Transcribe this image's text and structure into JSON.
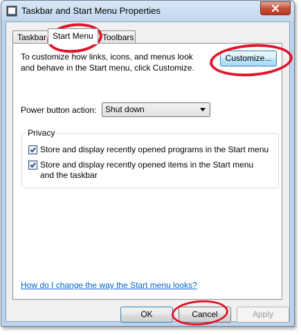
{
  "window": {
    "title": "Taskbar and Start Menu Properties"
  },
  "tabs": [
    {
      "label": "Taskbar"
    },
    {
      "label": "Start Menu",
      "selected": true
    },
    {
      "label": "Toolbars"
    }
  ],
  "start_menu": {
    "description": "To customize how links, icons, and menus look and behave in the Start menu, click Customize.",
    "customize_label": "Customize...",
    "power_button_label": "Power button action:",
    "power_button_value": "Shut down",
    "privacy": {
      "legend": "Privacy",
      "options": [
        {
          "label": "Store and display recently opened programs in the Start menu",
          "checked": true
        },
        {
          "label": "Store and display recently opened items in the Start menu and the taskbar",
          "checked": true
        }
      ]
    },
    "help_link": "How do I change the way the Start menu looks?"
  },
  "buttons": {
    "ok": "OK",
    "cancel": "Cancel",
    "apply": "Apply"
  },
  "colors": {
    "annotation": "#e0142a",
    "link": "#0066cc",
    "frame": "#bcd3ec"
  },
  "icons": {
    "app": "taskbar-properties-icon",
    "close": "close-icon",
    "check": "check-icon"
  }
}
